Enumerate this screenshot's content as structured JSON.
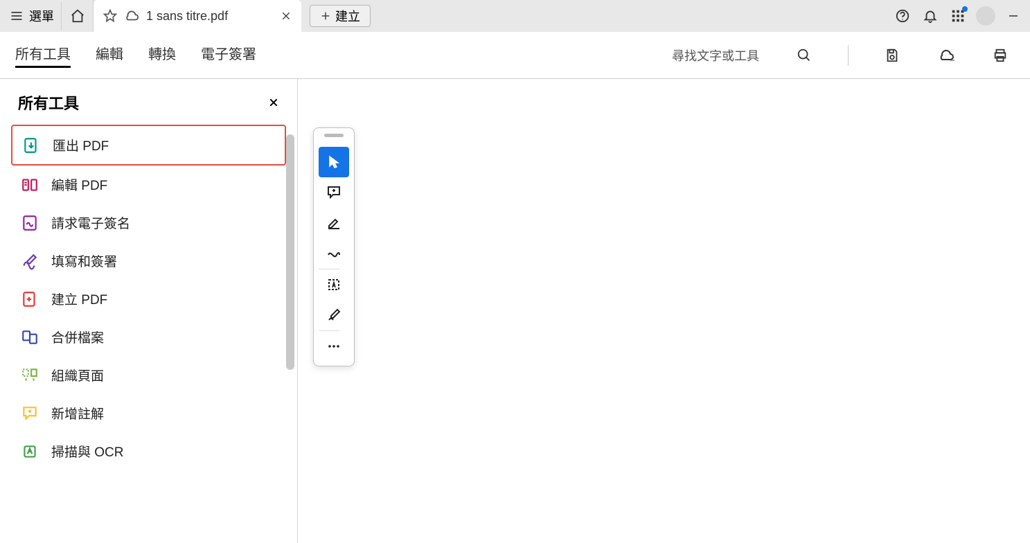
{
  "titlebar": {
    "menu_label": "選單",
    "tab_title": "1 sans titre.pdf",
    "create_label": "建立"
  },
  "toolbar": {
    "tabs": [
      {
        "label": "所有工具",
        "active": true
      },
      {
        "label": "編輯",
        "active": false
      },
      {
        "label": "轉換",
        "active": false
      },
      {
        "label": "電子簽署",
        "active": false
      }
    ],
    "find_label": "尋找文字或工具"
  },
  "panel": {
    "title": "所有工具",
    "items": [
      {
        "label": "匯出 PDF",
        "icon": "export-pdf-icon",
        "color": "#009688",
        "highlight": true
      },
      {
        "label": "編輯 PDF",
        "icon": "edit-pdf-icon",
        "color": "#c2185b",
        "highlight": false
      },
      {
        "label": "請求電子簽名",
        "icon": "request-sign-icon",
        "color": "#8e24aa",
        "highlight": false
      },
      {
        "label": "填寫和簽署",
        "icon": "fill-sign-icon",
        "color": "#673ab7",
        "highlight": false
      },
      {
        "label": "建立 PDF",
        "icon": "create-pdf-icon",
        "color": "#e53935",
        "highlight": false
      },
      {
        "label": "合併檔案",
        "icon": "combine-icon",
        "color": "#3949ab",
        "highlight": false
      },
      {
        "label": "組織頁面",
        "icon": "organize-icon",
        "color": "#7cb342",
        "highlight": false
      },
      {
        "label": "新增註解",
        "icon": "comment-icon",
        "color": "#fbc02d",
        "highlight": false
      },
      {
        "label": "掃描與 OCR",
        "icon": "scan-ocr-icon",
        "color": "#43a047",
        "highlight": false
      }
    ]
  },
  "quickbar": {
    "items": [
      {
        "name": "select-tool",
        "active": true
      },
      {
        "name": "add-comment-tool",
        "active": false
      },
      {
        "name": "highlight-tool",
        "active": false
      },
      {
        "name": "draw-tool",
        "active": false
      },
      {
        "name": "text-select-tool",
        "active": false
      },
      {
        "name": "fill-sign-tool",
        "active": false
      },
      {
        "name": "more-tools",
        "active": false
      }
    ]
  }
}
